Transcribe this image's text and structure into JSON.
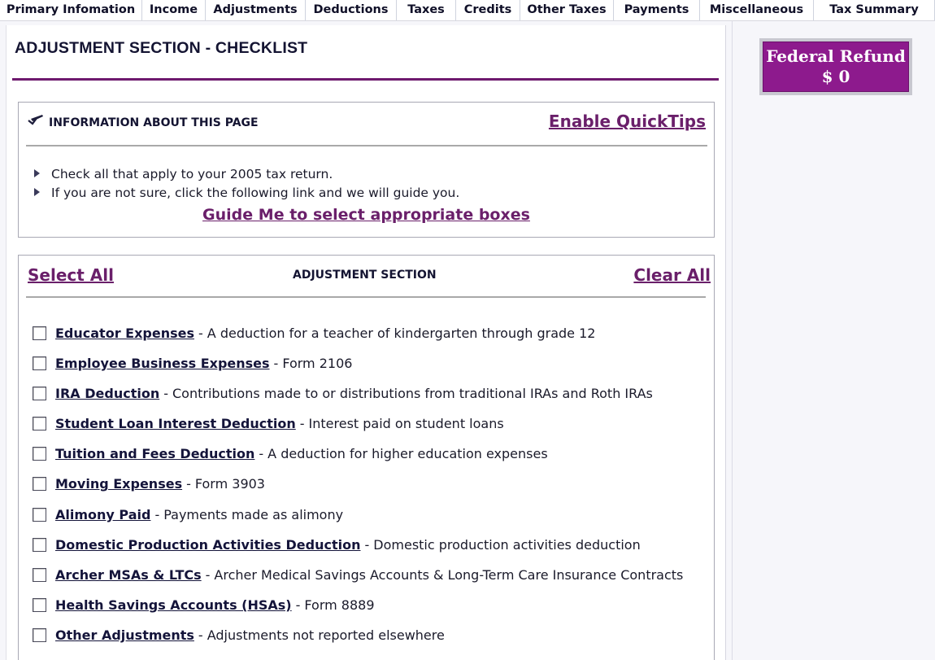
{
  "tabs": [
    {
      "label": "Primary Infomation",
      "w": 175
    },
    {
      "label": "Income",
      "w": 78
    },
    {
      "label": "Adjustments",
      "w": 123
    },
    {
      "label": "Deductions",
      "w": 112
    },
    {
      "label": "Taxes",
      "w": 73
    },
    {
      "label": "Credits",
      "w": 79
    },
    {
      "label": "Other Taxes",
      "w": 115
    },
    {
      "label": "Payments",
      "w": 106
    },
    {
      "label": "Miscellaneous",
      "w": 140
    },
    {
      "label": "Tax Summary",
      "w": 149
    }
  ],
  "page": {
    "title": "ADJUSTMENT SECTION - CHECKLIST"
  },
  "info": {
    "heading": "INFORMATION ABOUT THIS PAGE",
    "quicktips": "Enable QuickTips",
    "bullets": [
      "Check all that apply to your 2005 tax return.",
      "If you are not sure, click the following link and we will guide you."
    ],
    "guide_link": "Guide Me to select appropriate boxes",
    "icon": "pencil-check-icon"
  },
  "adjustments": {
    "select_all": "Select All",
    "heading": "ADJUSTMENT SECTION",
    "clear_all": "Clear All",
    "items": [
      {
        "label": "Educator Expenses",
        "desc": "A deduction for a teacher of kindergarten through grade 12",
        "checked": false
      },
      {
        "label": "Employee Business Expenses",
        "desc": "Form 2106",
        "checked": false
      },
      {
        "label": "IRA Deduction",
        "desc": "Contributions made to or distributions from traditional IRAs and Roth IRAs",
        "checked": false
      },
      {
        "label": "Student Loan Interest Deduction",
        "desc": "Interest paid on student loans",
        "checked": false
      },
      {
        "label": "Tuition and Fees Deduction",
        "desc": "A deduction for higher education expenses",
        "checked": false
      },
      {
        "label": "Moving Expenses",
        "desc": "Form 3903",
        "checked": false
      },
      {
        "label": "Alimony Paid",
        "desc": "Payments made as alimony",
        "checked": false
      },
      {
        "label": "Domestic Production Activities Deduction",
        "desc": "Domestic production activities deduction",
        "checked": false
      },
      {
        "label": "Archer MSAs & LTCs",
        "desc": "Archer Medical Savings Accounts & Long-Term Care Insurance Contracts",
        "checked": false
      },
      {
        "label": "Health Savings Accounts (HSAs)",
        "desc": "Form 8889",
        "checked": false
      },
      {
        "label": "Other Adjustments",
        "desc": "Adjustments not reported elsewhere",
        "checked": false
      }
    ]
  },
  "refund": {
    "title": "Federal Refund",
    "amount": "$ 0"
  },
  "colors": {
    "accent_purple": "#6a1f6a",
    "refund_bg": "#8d1a8d",
    "navy_text": "#14143a"
  }
}
